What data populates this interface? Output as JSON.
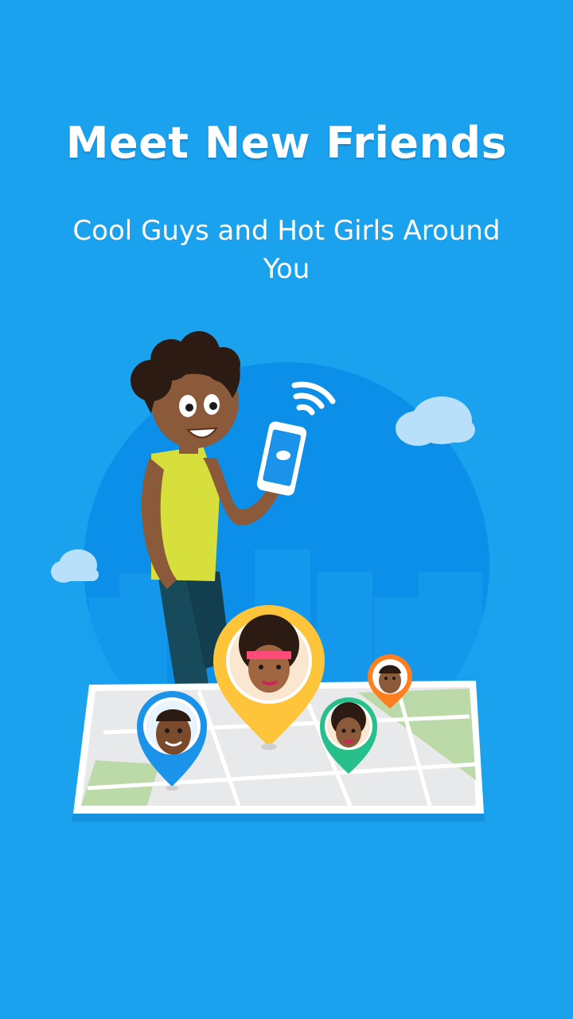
{
  "onboarding": {
    "title": "Meet New Friends",
    "subtitle": "Cool Guys and Hot Girls Around You"
  },
  "colors": {
    "background": "#1aa2ee",
    "circle": "#0b8fe8",
    "shirt": "#d7df3c",
    "pin_yellow": "#ffc53a",
    "pin_blue": "#1c93ea",
    "pin_green": "#27c08a",
    "pin_orange": "#ff7f1e"
  }
}
